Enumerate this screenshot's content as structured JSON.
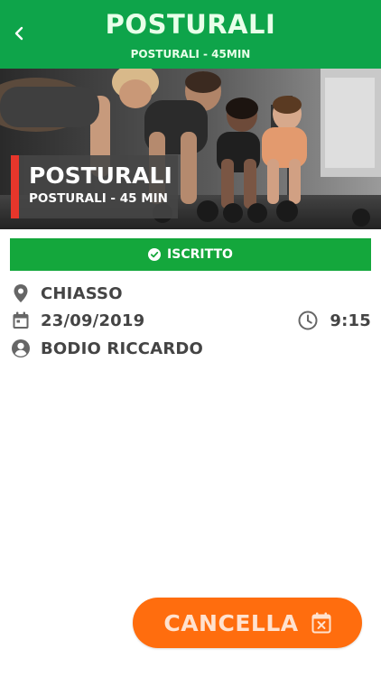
{
  "header": {
    "title": "POSTURALI",
    "subtitle": "POSTURALI - 45MIN"
  },
  "hero": {
    "title": "POSTURALI",
    "subtitle": "POSTURALI - 45 MIN"
  },
  "status": {
    "label": "ISCRITTO",
    "icon": "check-circle-icon",
    "color": "#14a73c"
  },
  "details": {
    "location": "CHIASSO",
    "date": "23/09/2019",
    "time": "9:15",
    "instructor": "BODIO RICCARDO"
  },
  "actions": {
    "cancel_label": "CANCELLA",
    "cancel_color": "#ff6d0e"
  },
  "colors": {
    "header_green": "#0ea44a",
    "accent_red": "#e6362b"
  }
}
